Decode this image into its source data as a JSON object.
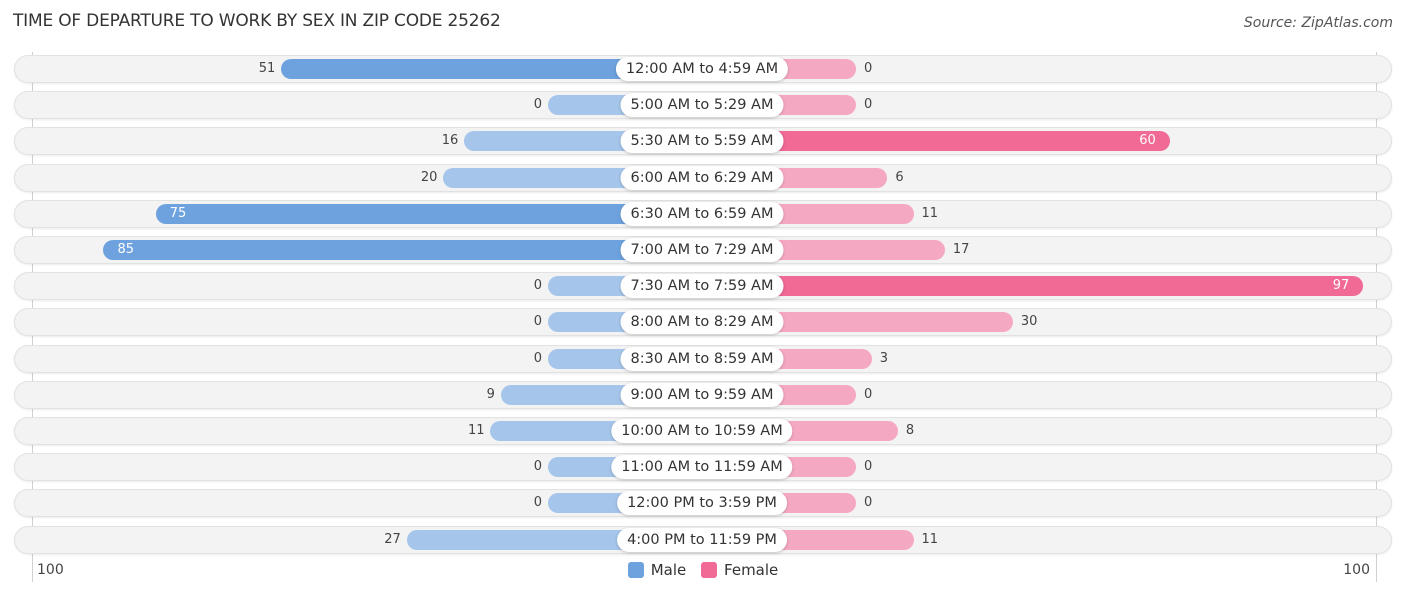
{
  "title": "TIME OF DEPARTURE TO WORK BY SEX IN ZIP CODE 25262",
  "source": "Source: ZipAtlas.com",
  "colors": {
    "male_light": "#a5c5ea",
    "male_strong": "#6da2de",
    "female_light": "#f5a8c2",
    "female_strong": "#f06a95",
    "legend_male": "#6da2de",
    "legend_female": "#f06a95"
  },
  "chart_data": {
    "type": "bar",
    "orientation": "horizontal-diverging",
    "title": "TIME OF DEPARTURE TO WORK BY SEX IN ZIP CODE 25262",
    "categories": [
      "12:00 AM to 4:59 AM",
      "5:00 AM to 5:29 AM",
      "5:30 AM to 5:59 AM",
      "6:00 AM to 6:29 AM",
      "6:30 AM to 6:59 AM",
      "7:00 AM to 7:29 AM",
      "7:30 AM to 7:59 AM",
      "8:00 AM to 8:29 AM",
      "8:30 AM to 8:59 AM",
      "9:00 AM to 9:59 AM",
      "10:00 AM to 10:59 AM",
      "11:00 AM to 11:59 AM",
      "12:00 PM to 3:59 PM",
      "4:00 PM to 11:59 PM"
    ],
    "series": [
      {
        "name": "Male",
        "values": [
          51,
          0,
          16,
          20,
          75,
          85,
          0,
          0,
          0,
          9,
          11,
          0,
          0,
          27
        ]
      },
      {
        "name": "Female",
        "values": [
          0,
          0,
          60,
          6,
          11,
          17,
          97,
          30,
          3,
          0,
          8,
          0,
          0,
          11
        ]
      }
    ],
    "axis": {
      "left_label": "100",
      "right_label": "100",
      "range": [
        0,
        100
      ]
    },
    "legend": {
      "position": "bottom-center",
      "entries": [
        "Male",
        "Female"
      ]
    }
  }
}
